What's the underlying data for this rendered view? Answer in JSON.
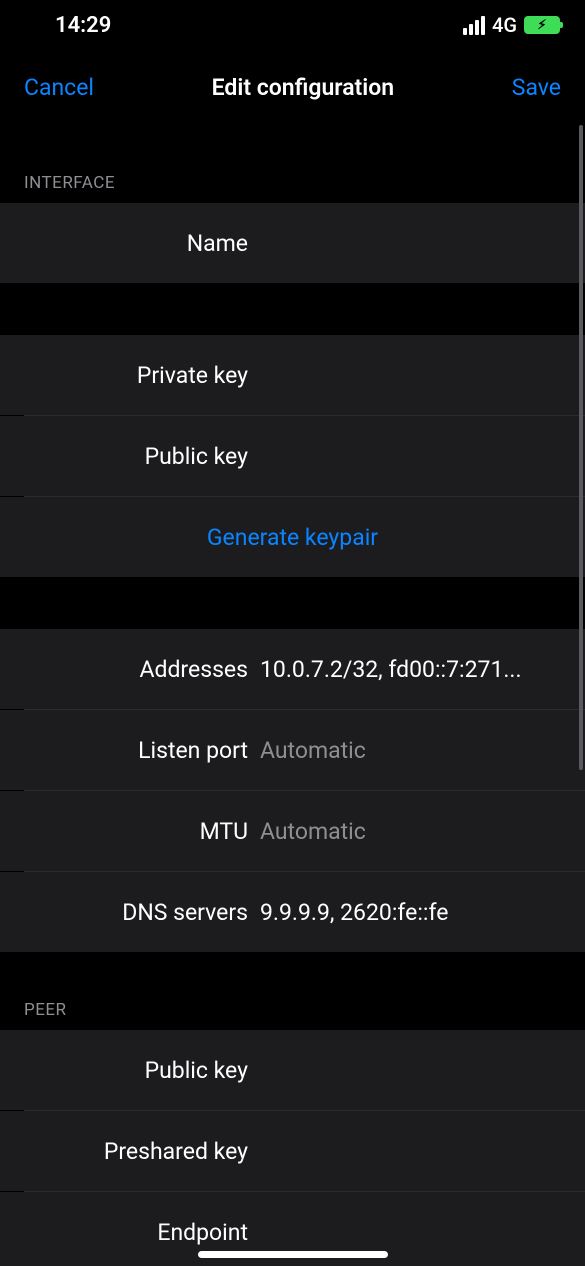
{
  "status": {
    "time": "14:29",
    "network": "4G"
  },
  "nav": {
    "cancel": "Cancel",
    "title": "Edit configuration",
    "save": "Save"
  },
  "sections": {
    "interface": {
      "header": "Interface",
      "name_label": "Name",
      "name_value": "",
      "private_key_label": "Private key",
      "private_key_value": "",
      "public_key_label": "Public key",
      "public_key_value": "",
      "generate_keypair": "Generate keypair",
      "addresses_label": "Addresses",
      "addresses_value": "10.0.7.2/32, fd00::7:271...",
      "listen_port_label": "Listen port",
      "listen_port_placeholder": "Automatic",
      "mtu_label": "MTU",
      "mtu_placeholder": "Automatic",
      "dns_label": "DNS servers",
      "dns_value": "9.9.9.9, 2620:fe::fe"
    },
    "peer": {
      "header": "Peer",
      "public_key_label": "Public key",
      "public_key_value": "",
      "preshared_key_label": "Preshared key",
      "preshared_key_value": "",
      "endpoint_label": "Endpoint",
      "endpoint_value": ""
    }
  }
}
